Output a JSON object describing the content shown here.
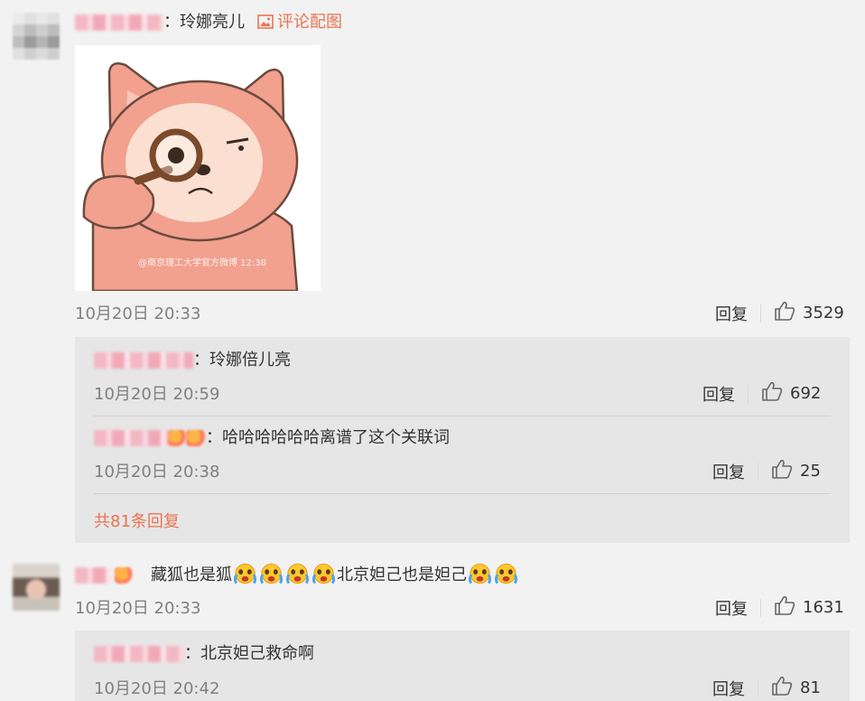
{
  "comment1": {
    "colon": "：",
    "text": "玲娜亮儿",
    "image_link": "评论配图",
    "time": "10月20日 20:33",
    "reply_label": "回复",
    "likes": "3529",
    "image_caption": "@南京理工大学官方微博 12:38"
  },
  "comment1_replies": [
    {
      "colon": "：",
      "text": "玲娜倍儿亮",
      "time": "10月20日 20:59",
      "reply_label": "回复",
      "likes": "692"
    },
    {
      "colon": "：",
      "text": "哈哈哈哈哈哈离谱了这个关联词",
      "time": "10月20日 20:38",
      "reply_label": "回复",
      "likes": "25"
    }
  ],
  "comment1_more": "共81条回复",
  "comment2": {
    "text_a": "藏狐也是狐",
    "text_b": "北京妲己也是妲己",
    "time": "10月20日 20:33",
    "reply_label": "回复",
    "likes": "1631"
  },
  "comment2_replies": [
    {
      "colon": "：",
      "text": "北京妲己救命啊",
      "time": "10月20日 20:42",
      "reply_label": "回复",
      "likes": "81"
    }
  ],
  "colors": {
    "accent": "#eb7350",
    "background": "#f2f2f2",
    "reply_bg": "#e6e6e6",
    "muted": "#808080"
  },
  "icons": [
    "image-icon",
    "thumbs-up-icon",
    "crying-emoji-icon"
  ]
}
